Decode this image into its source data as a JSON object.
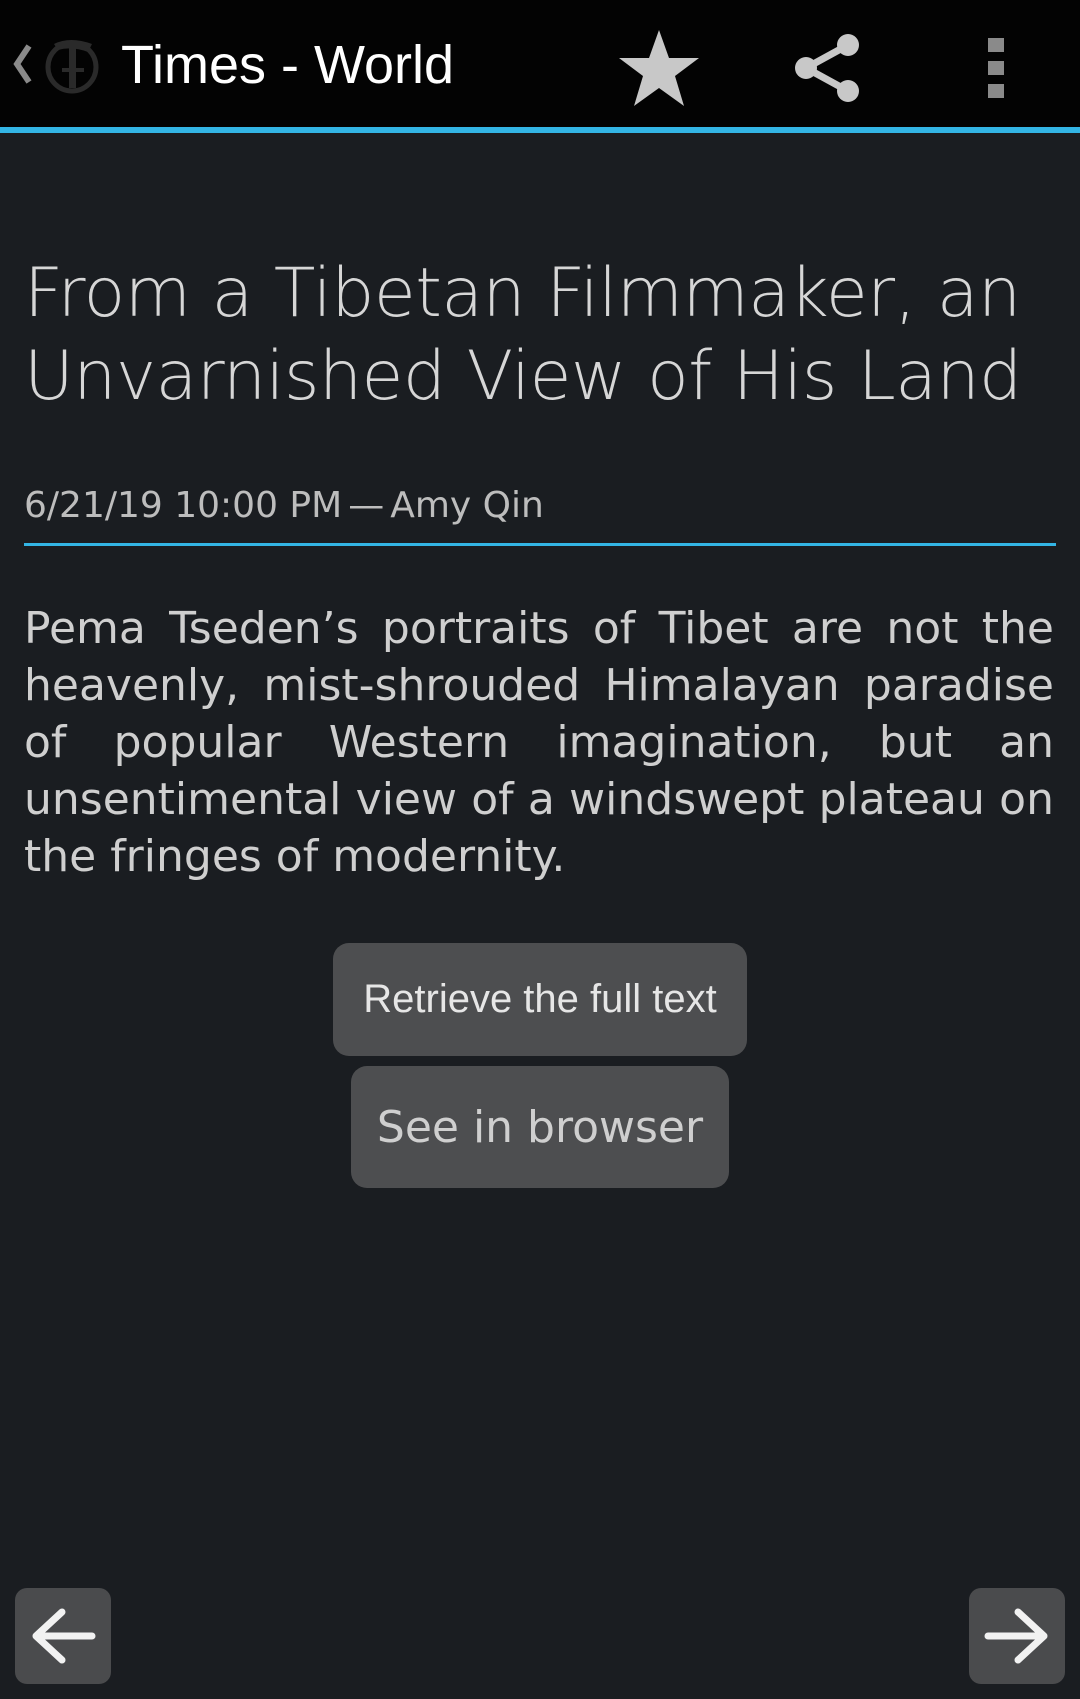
{
  "header": {
    "title": "Times - World",
    "logo_icon": "nyt-logo-icon",
    "accent_color": "#33b5e5",
    "actions": [
      {
        "name": "favorite",
        "icon": "star-icon"
      },
      {
        "name": "share",
        "icon": "share-icon"
      },
      {
        "name": "more",
        "icon": "overflow-menu-icon"
      }
    ]
  },
  "article": {
    "title": "From a Tibetan Filmmaker, an Unvarnished View of His Land",
    "date": "6/21/19 10:00 PM",
    "separator": "—",
    "author": "Amy Qin",
    "summary": "Pema Tseden’s portraits of Tibet are not the heavenly, mist-shrouded Himalayan paradise of popular Western imagination, but an unsentimental view of a windswept plateau on the fringes of modernity."
  },
  "buttons": {
    "full_text_label": "Retrieve the full text",
    "browser_label": "See in browser"
  },
  "navigation": {
    "previous_icon": "arrow-left-icon",
    "next_icon": "arrow-right-icon"
  }
}
